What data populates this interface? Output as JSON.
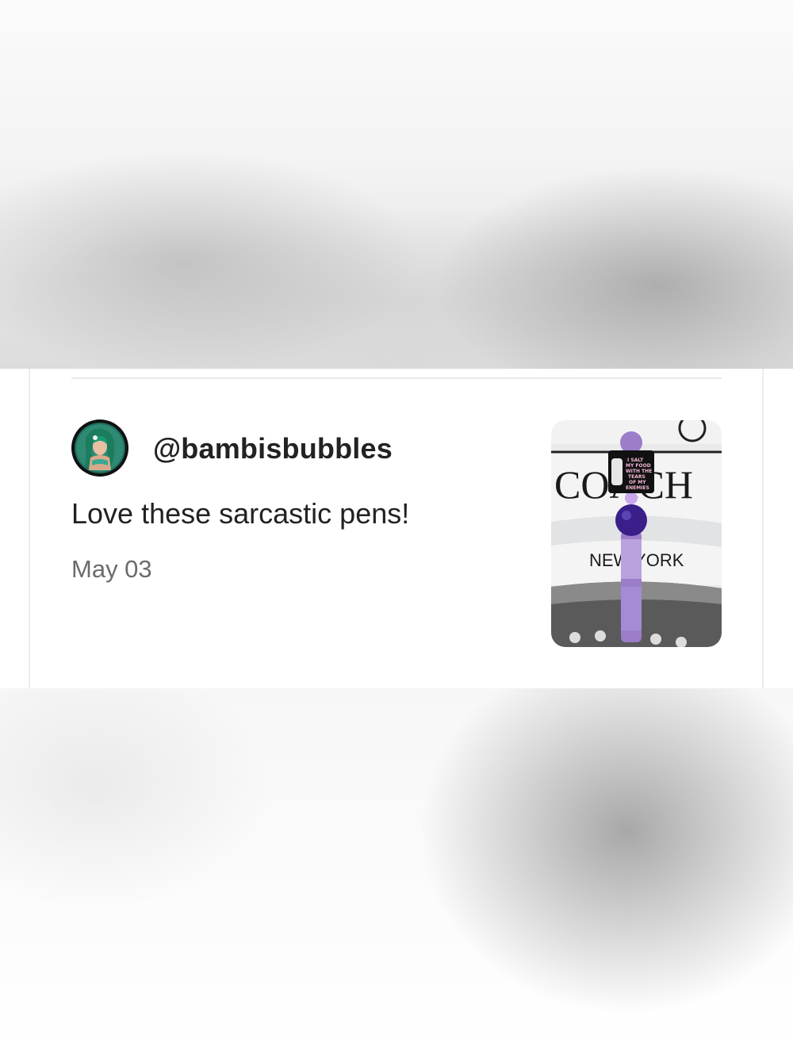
{
  "review": {
    "username": "@bambisbubbles",
    "text": "Love these sarcastic pens!",
    "date": "May 03"
  },
  "avatar": {
    "icon": "mermaid-avatar-icon"
  },
  "photo": {
    "icon": "pen-product-photo",
    "sign_text": "COACH",
    "sign_subtext": "NEW YORK",
    "charm_text": [
      "I SALT",
      "MY FOOD",
      "WITH THE",
      "TEARS",
      "OF MY",
      "ENEMIES"
    ]
  },
  "colors": {
    "text": "#222222",
    "date": "#6b6b6b",
    "accent_purple": "#6a3fb2"
  }
}
